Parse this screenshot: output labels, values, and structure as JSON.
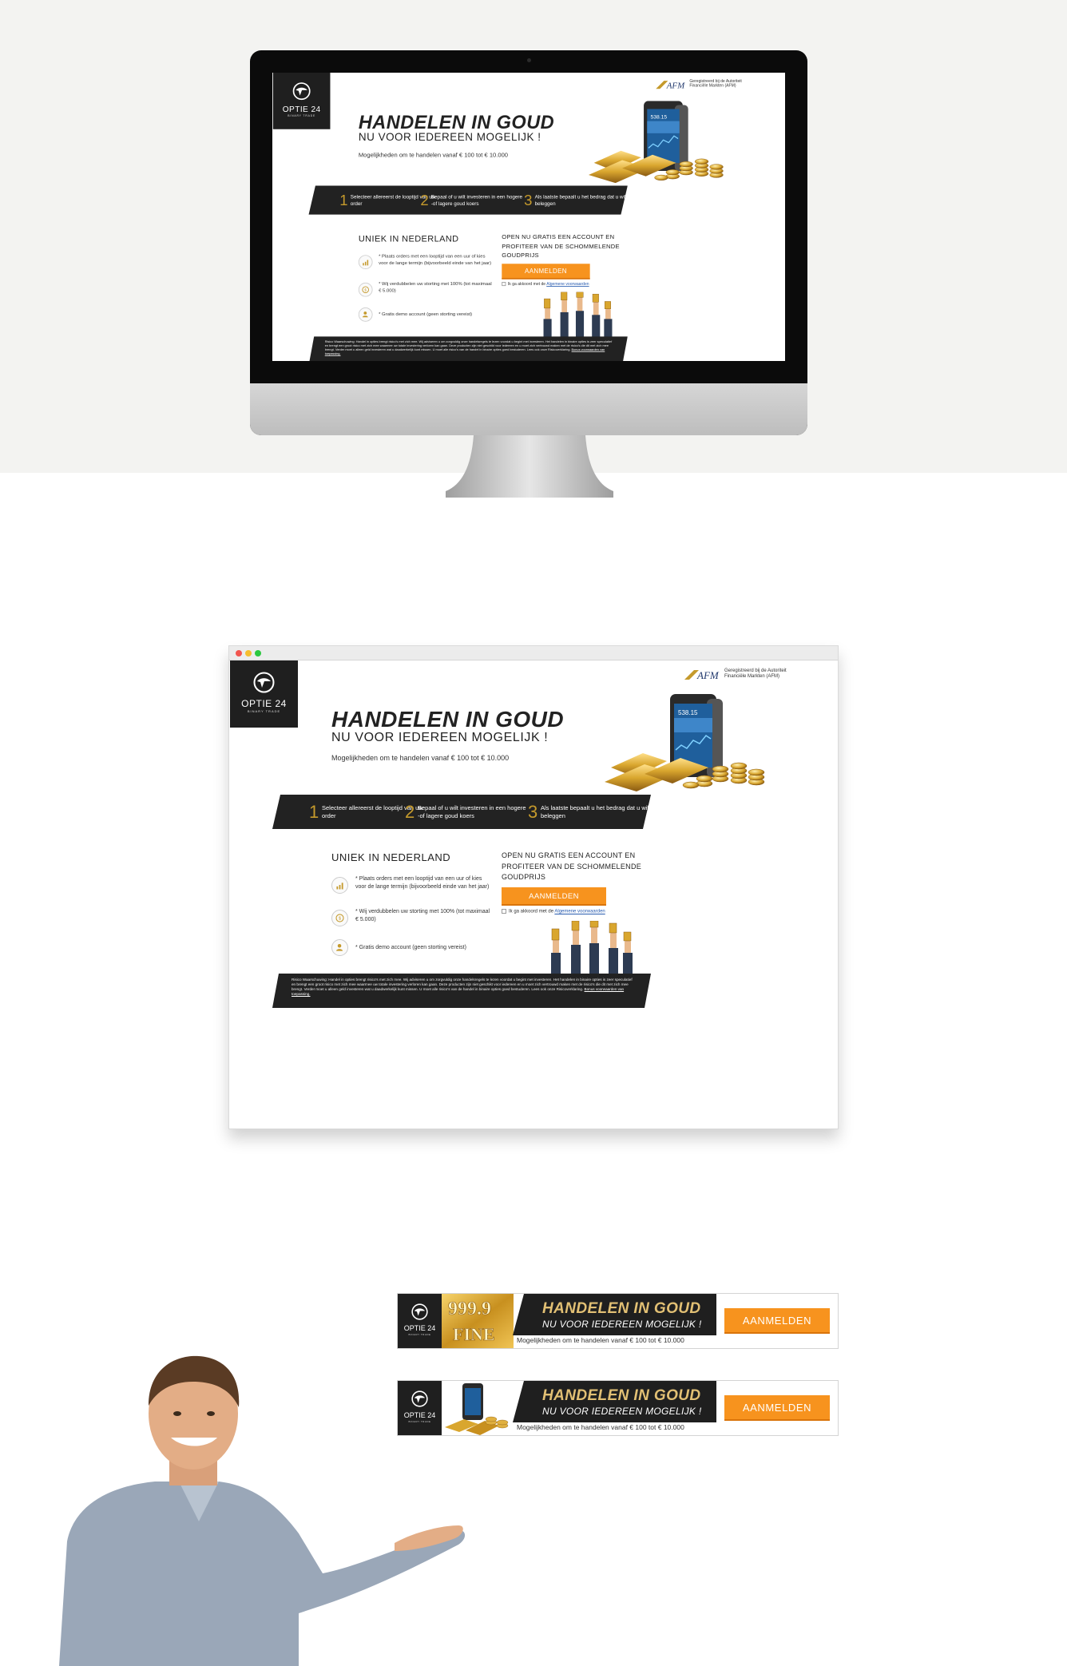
{
  "landing": {
    "logo": {
      "name": "OPTIE 24",
      "tagline": "BINARY TRADE"
    },
    "afm": {
      "mark": "AFM",
      "text": "Geregistreerd bij de Autoriteit Financiële Markten (AFM)"
    },
    "headline": "HANDELEN IN GOUD",
    "subheadline": "NU VOOR IEDEREEN MOGELIJK !",
    "intro": "Mogelijkheden om te handelen vanaf € 100 tot € 10.000",
    "steps": [
      {
        "n": "1",
        "text": "Selecteer allereerst de looptijd van uw order"
      },
      {
        "n": "2",
        "text": "Bepaal of u wilt investeren in een hogere -of lagere goud koers"
      },
      {
        "n": "3",
        "text": "Als laatste bepaalt u het bedrag dat u wilt beleggen"
      }
    ],
    "unique_title": "UNIEK IN NEDERLAND",
    "features": [
      {
        "icon": "chart-icon",
        "text": "* Plaats orders met een looptijd van een uur of kies voor de lange termijn (bijvoorbeeld einde van het jaar)"
      },
      {
        "icon": "coin-icon",
        "text": "* Wij verdubbelen uw storting met 100% (tot maximaal € 5.000)"
      },
      {
        "icon": "user-icon",
        "text": "* Gratis demo account (geen storting vereist)"
      }
    ],
    "cta_title": "OPEN NU GRATIS EEN ACCOUNT EN PROFITEER VAN DE SCHOMMELENDE GOUDPRIJS",
    "cta_button": "AANMELDEN",
    "agree_text": "Ik ga akkoord met de",
    "agree_link": "Algemene voorwaarden",
    "phone_price": "538.15",
    "risk_text": "Risico Waarschuwing: Handel in opties brengt risico's met zich mee. Wij adviseren u om zorgvuldig onze handelsregels te lezen voordat u begint met investeren. Het handelen in binaire opties is zeer speculatief en brengt een groot risico met zich mee waarmee uw totale investering verloren kan gaan. Deze producten zijn niet geschikt voor iedereen en u moet zich vertrouwd maken met de risico's die dit met zich mee brengt. Verder moet u alleen geld investeren wat u daadwerkelijk kunt missen. U moet alle risico's van de handel in binaire opties goed bestuderen. Lees ook onze Risicoverklaring.",
    "risk_link": "Bonus voorwaarden van toepassing."
  },
  "banners": [
    {
      "logo_name": "OPTIE 24",
      "logo_tagline": "BINARY TRADE",
      "visual_text_1": "999.9",
      "visual_text_2": "FINE",
      "headline": "HANDELEN IN GOUD",
      "subheadline": "NU VOOR IEDEREEN MOGELIJK !",
      "text": "Mogelijkheden om te handelen vanaf  € 100 tot € 10.000",
      "button": "AANMELDEN"
    },
    {
      "logo_name": "OPTIE 24",
      "logo_tagline": "BINARY TRADE",
      "headline": "HANDELEN IN GOUD",
      "subheadline": "NU VOOR IEDEREEN MOGELIJK !",
      "text": "Mogelijkheden om te handelen vanaf  € 100 tot € 10.000",
      "button": "AANMELDEN"
    }
  ],
  "colors": {
    "accent": "#f7931e",
    "dark": "#1f1f1f",
    "gold": "#c59a2c",
    "link": "#2a5db0"
  }
}
